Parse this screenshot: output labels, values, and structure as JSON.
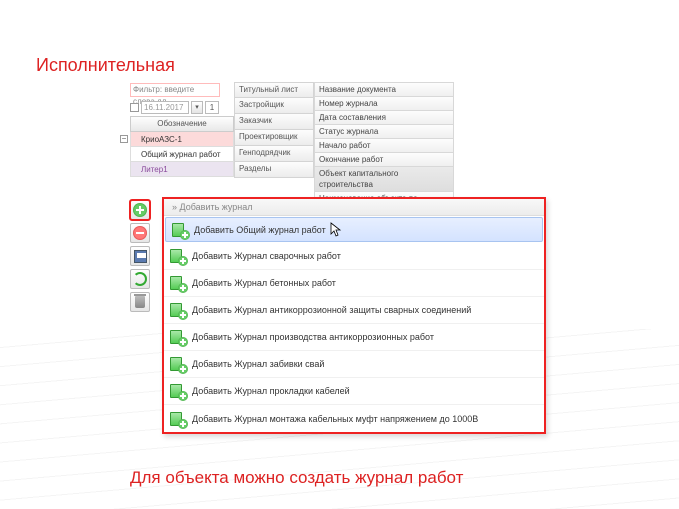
{
  "title": "Исполнительная",
  "caption": "Для объекта можно создать журнал работ",
  "filter_placeholder": "Фильтр: введите слова дл",
  "date_value": "16.11.2017",
  "date_extra": "1",
  "tree": {
    "header": "Обозначение",
    "items": [
      {
        "label": "КриоАЗС-1",
        "cls": "pink"
      },
      {
        "label": "Общий журнал работ",
        "cls": "white"
      },
      {
        "label": "Литер1",
        "cls": "lav"
      }
    ]
  },
  "mid_panel": [
    "Титульный лист",
    "Застройщик",
    "Заказчик",
    "Проектировщик",
    "Генподрядчик",
    "Разделы"
  ],
  "right_panel": [
    {
      "label": "Название документа"
    },
    {
      "label": "Номер журнала"
    },
    {
      "label": "Дата составления"
    },
    {
      "label": "Статус журнала"
    },
    {
      "label": "Начало работ"
    },
    {
      "label": "Окончание работ"
    },
    {
      "label": "Объект капитального строительства",
      "sel": true
    },
    {
      "label": "Наименование объекта по разрешению на",
      "multi": true
    }
  ],
  "dropdown": {
    "header": "» Добавить журнал",
    "items": [
      "Добавить Общий журнал работ",
      "Добавить Журнал сварочных работ",
      "Добавить Журнал бетонных работ",
      "Добавить Журнал антикоррозионной защиты сварных соединений",
      "Добавить Журнал производства антикоррозионных работ",
      "Добавить Журнал забивки свай",
      "Добавить Журнал прокладки кабелей",
      "Добавить Журнал монтажа кабельных муфт напряжением до 1000В"
    ]
  }
}
